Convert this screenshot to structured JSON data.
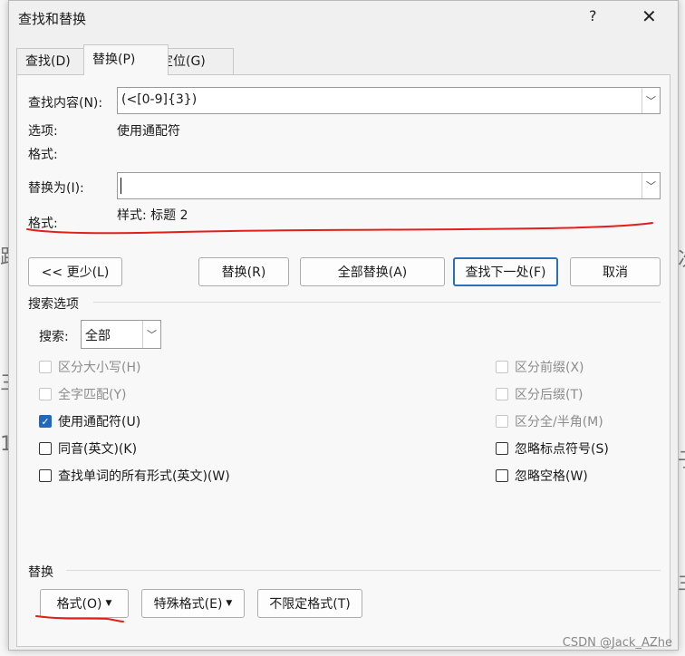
{
  "window": {
    "title": "查找和替换",
    "help": "?",
    "close": "✕"
  },
  "tabs": [
    {
      "label": "查找(D)"
    },
    {
      "label": "替换(P)"
    },
    {
      "label": "定位(G)"
    }
  ],
  "find": {
    "label": "查找内容(N):",
    "value": "(<[0-9]{3})",
    "options_label": "选项:",
    "options_value": "使用通配符",
    "format_label": "格式:"
  },
  "replace": {
    "label": "替换为(I):",
    "value": "",
    "format_label": "格式:",
    "format_value": "样式: 标题 2"
  },
  "buttons": {
    "less": "<< 更少(L)",
    "replace": "替换(R)",
    "replace_all": "全部替换(A)",
    "find_next": "查找下一处(F)",
    "cancel": "取消"
  },
  "search_options": {
    "heading": "搜索选项",
    "search_label": "搜索:",
    "search_value": "全部",
    "left": [
      {
        "label": "区分大小写(H)",
        "checked": false,
        "disabled": true
      },
      {
        "label": "全字匹配(Y)",
        "checked": false,
        "disabled": true
      },
      {
        "label": "使用通配符(U)",
        "checked": true,
        "disabled": false
      },
      {
        "label": "同音(英文)(K)",
        "checked": false,
        "disabled": false
      },
      {
        "label": "查找单词的所有形式(英文)(W)",
        "checked": false,
        "disabled": false
      }
    ],
    "right": [
      {
        "label": "区分前缀(X)",
        "checked": false,
        "disabled": true
      },
      {
        "label": "区分后缀(T)",
        "checked": false,
        "disabled": true
      },
      {
        "label": "区分全/半角(M)",
        "checked": false,
        "disabled": true
      },
      {
        "label": "忽略标点符号(S)",
        "checked": false,
        "disabled": false
      },
      {
        "label": "忽略空格(W)",
        "checked": false,
        "disabled": false
      }
    ]
  },
  "replace_section": {
    "heading": "替换",
    "format_btn": "格式(O)",
    "special_btn": "特殊格式(E)",
    "no_format_btn": "不限定格式(T)"
  },
  "watermark": "CSDN @Jack_AZhe",
  "colors": {
    "accent": "#1f68c0",
    "annotation": "#e0201b",
    "default_border": "#2b6fb5"
  },
  "icons": {
    "dropdown": "chevron-down-icon",
    "checkmark": "check-icon",
    "menu_arrow": "caret-down-icon"
  }
}
